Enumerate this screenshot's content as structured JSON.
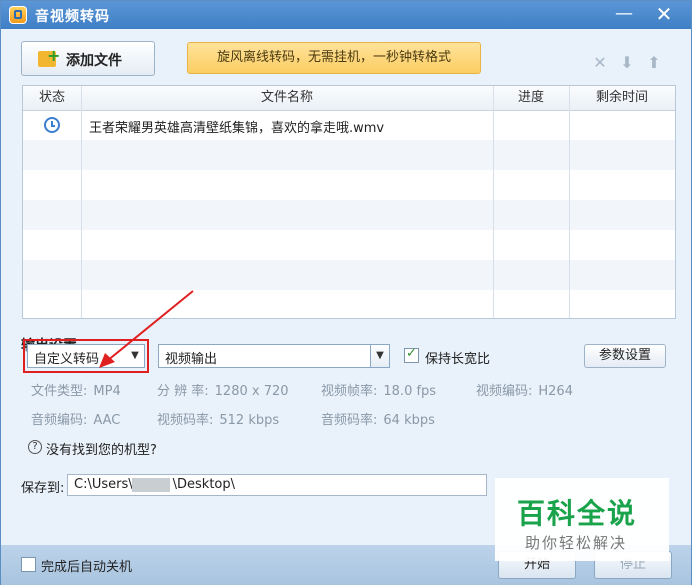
{
  "window": {
    "title": "音视频转码",
    "minimize_glyph": "—",
    "close_glyph": "✕"
  },
  "toolbar": {
    "add_file_label": "添加文件",
    "promo_text": "旋风离线转码，无需挂机，一秒钟转格式",
    "icons": [
      "delete-x-icon",
      "move-down-icon",
      "move-up-icon"
    ]
  },
  "table": {
    "columns": [
      "状态",
      "文件名称",
      "进度",
      "剩余时间"
    ],
    "rows": [
      {
        "status_icon": "clock-icon",
        "file_name": "王者荣耀男英雄高清壁纸集锦，喜欢的拿走哦.wmv",
        "progress": "",
        "remaining": ""
      }
    ]
  },
  "output": {
    "section_title": "输出设置",
    "preset_value": "自定义转码",
    "output_type_value": "视频输出",
    "keep_ratio_label": "保持长宽比",
    "keep_ratio_checked": true,
    "param_button": "参数设置",
    "info": [
      {
        "label": "文件类型:",
        "value": "MP4"
      },
      {
        "label": "分 辨 率:",
        "value": "1280 x 720"
      },
      {
        "label": "视频帧率:",
        "value": "18.0 fps"
      },
      {
        "label": "视频编码:",
        "value": "H264"
      },
      {
        "label": "音频编码:",
        "value": "AAC"
      },
      {
        "label": "视频码率:",
        "value": "512 kbps"
      },
      {
        "label": "音频码率:",
        "value": "64 kbps"
      }
    ],
    "help_text": "没有找到您的机型?"
  },
  "save": {
    "label": "保存到:",
    "path_prefix": "C:\\Users\\",
    "path_suffix": "\\Desktop\\"
  },
  "bottom": {
    "auto_shutdown_label": "完成后自动关机",
    "start_button": "开始",
    "stop_button": "停止"
  },
  "watermark": {
    "main": "百科全说",
    "sub": "助你轻松解决"
  }
}
